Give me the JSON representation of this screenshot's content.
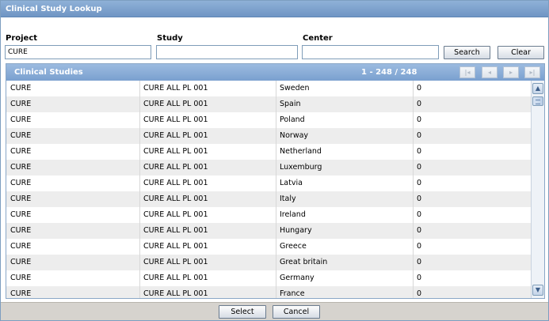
{
  "window": {
    "title": "Clinical Study Lookup"
  },
  "filters": {
    "project": {
      "label": "Project",
      "value": "CURE"
    },
    "study": {
      "label": "Study",
      "value": ""
    },
    "center": {
      "label": "Center",
      "value": ""
    },
    "search_label": "Search",
    "clear_label": "Clear"
  },
  "grid": {
    "title": "Clinical Studies",
    "count": "1 - 248 / 248",
    "pager_icons": [
      "first-page-icon",
      "prev-page-icon",
      "next-page-icon",
      "last-page-icon"
    ],
    "rows": [
      [
        "CURE",
        "CURE ALL PL 001",
        "Sweden",
        "0"
      ],
      [
        "CURE",
        "CURE ALL PL 001",
        "Spain",
        "0"
      ],
      [
        "CURE",
        "CURE ALL PL 001",
        "Poland",
        "0"
      ],
      [
        "CURE",
        "CURE ALL PL 001",
        "Norway",
        "0"
      ],
      [
        "CURE",
        "CURE ALL PL 001",
        "Netherland",
        "0"
      ],
      [
        "CURE",
        "CURE ALL PL 001",
        "Luxemburg",
        "0"
      ],
      [
        "CURE",
        "CURE ALL PL 001",
        "Latvia",
        "0"
      ],
      [
        "CURE",
        "CURE ALL PL 001",
        "Italy",
        "0"
      ],
      [
        "CURE",
        "CURE ALL PL 001",
        "Ireland",
        "0"
      ],
      [
        "CURE",
        "CURE ALL PL 001",
        "Hungary",
        "0"
      ],
      [
        "CURE",
        "CURE ALL PL 001",
        "Greece",
        "0"
      ],
      [
        "CURE",
        "CURE ALL PL 001",
        "Great britain",
        "0"
      ],
      [
        "CURE",
        "CURE ALL PL 001",
        "Germany",
        "0"
      ],
      [
        "CURE",
        "CURE ALL PL 001",
        "France",
        "0"
      ]
    ]
  },
  "footer": {
    "select_label": "Select",
    "cancel_label": "Cancel"
  },
  "colors": {
    "header_blue": "#7aa0cf",
    "title_blue": "#6f95c4",
    "footer_gray": "#d6d3ce"
  }
}
